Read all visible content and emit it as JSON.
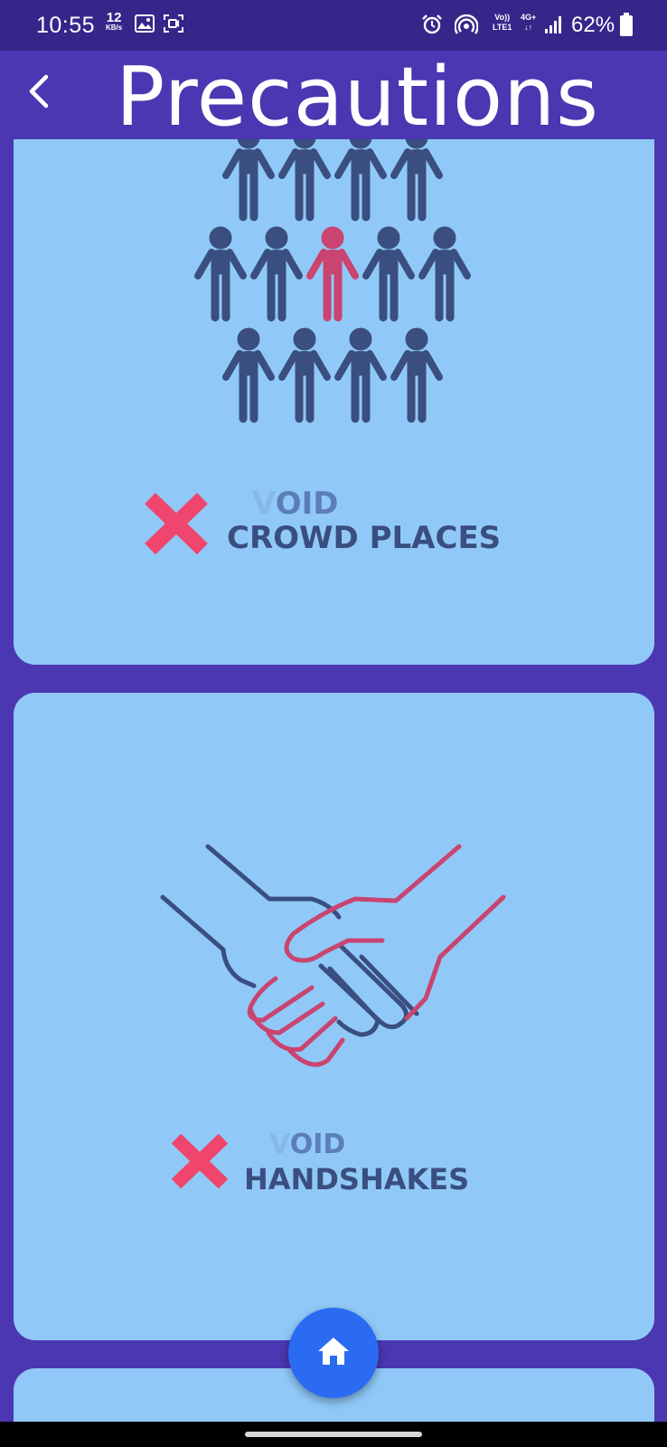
{
  "status_bar": {
    "time": "10:55",
    "speed_value": "12",
    "speed_unit": "KB/s",
    "volte_label": "Vo))",
    "lte_label": "LTE1",
    "network_label": "4G+",
    "network_arrows": "↓↑",
    "battery": "62%",
    "icons": [
      "gallery-icon",
      "screen-record-icon",
      "alarm-icon",
      "hotspot-icon",
      "signal-icon",
      "battery-icon"
    ]
  },
  "app_bar": {
    "title": "Precautions",
    "back_icon": "chevron-left-icon"
  },
  "cards": [
    {
      "illustration": "crowd-people-icon",
      "mark_icon": "x-mark-icon",
      "line1_faded": "V",
      "line1_main": "OID",
      "line2": "CROWD PLACES"
    },
    {
      "illustration": "handshake-icon",
      "mark_icon": "x-mark-icon",
      "line1_faded": "V",
      "line1_main": "OID",
      "line2": "HANDSHAKES"
    }
  ],
  "fab": {
    "icon": "home-icon"
  },
  "colors": {
    "background": "#4b37b1",
    "status_bar": "#35278a",
    "card": "#90c9f8",
    "figure": "#3a4e80",
    "accent": "#c94470",
    "x_mark": "#f0456c",
    "fab": "#2a6bf2"
  }
}
